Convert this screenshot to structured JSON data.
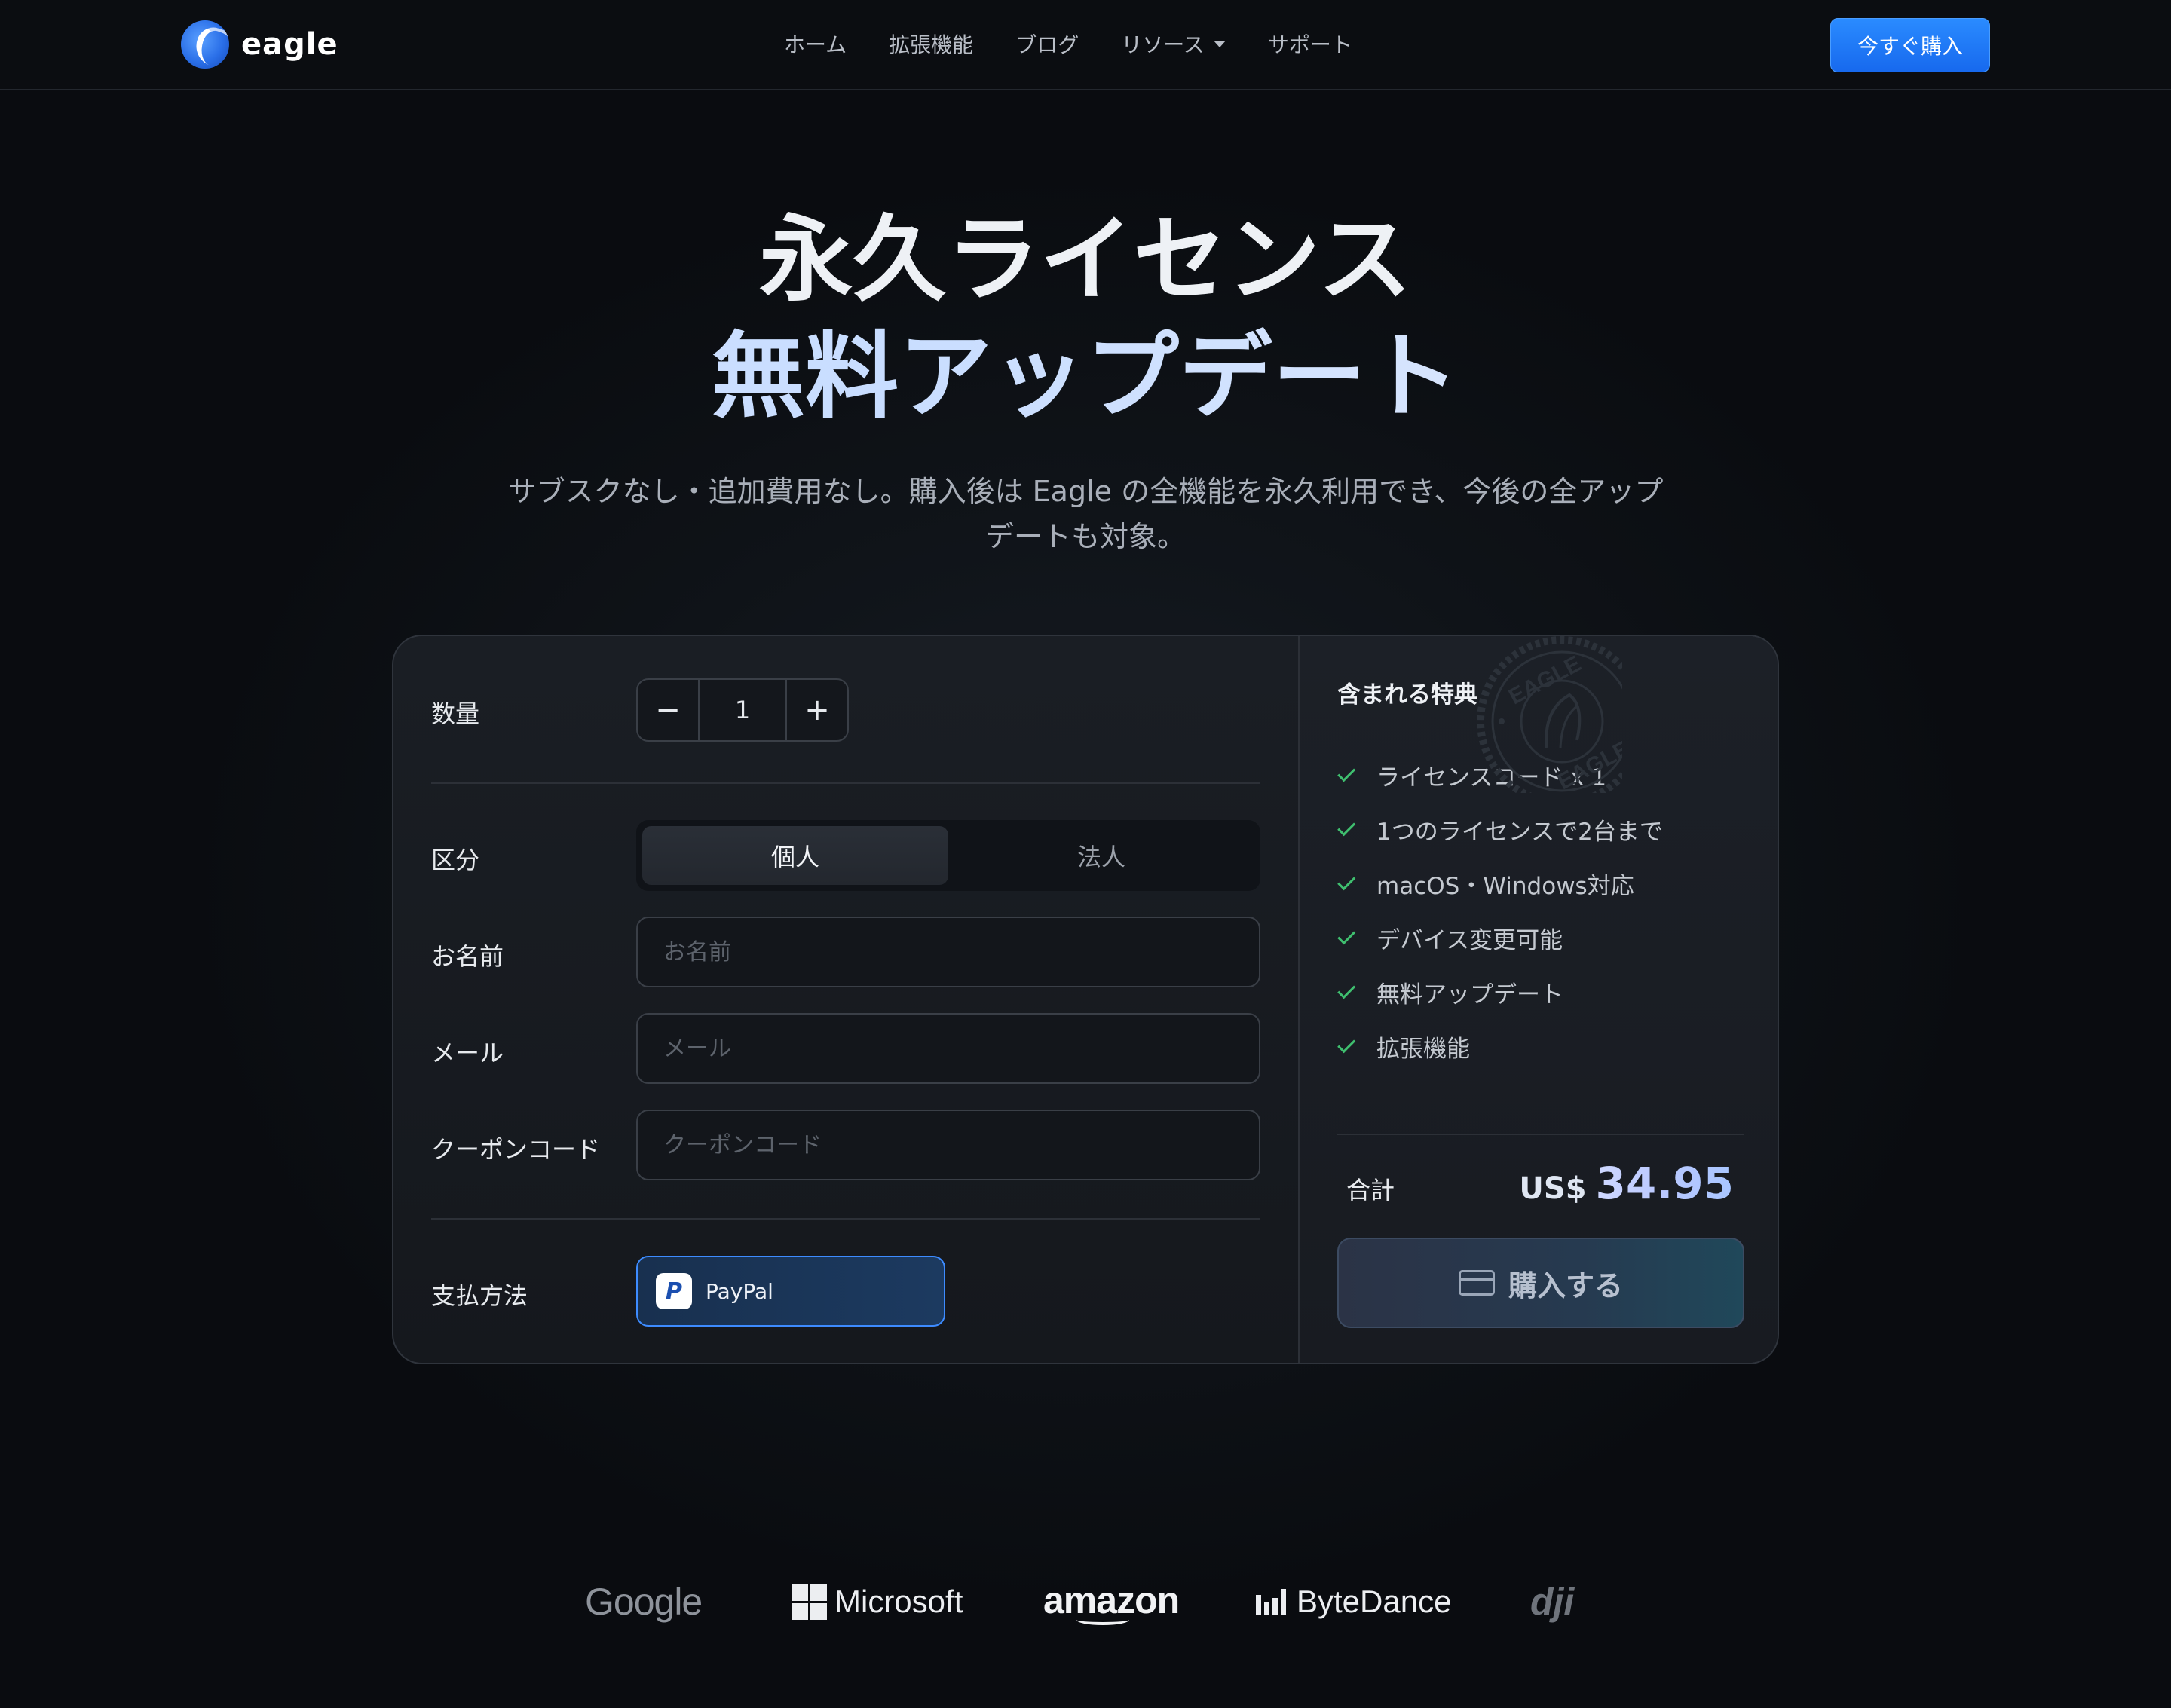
{
  "nav": {
    "brand": "eagle",
    "items": [
      {
        "label": "ホーム"
      },
      {
        "label": "拡張機能"
      },
      {
        "label": "ブログ"
      },
      {
        "label": "リソース"
      },
      {
        "label": "サポート"
      }
    ],
    "cta": "今すぐ購入"
  },
  "hero": {
    "line1": "永久ライセンス",
    "line2": "無料アップデート",
    "subtitle": "サブスクなし・追加費用なし。購入後は Eagle の全機能を永久利用でき、今後の全アップデートも対象。"
  },
  "form": {
    "quantity_label": "数量",
    "quantity_value": "1",
    "minus": "−",
    "plus": "+",
    "type_label": "区分",
    "type_options": [
      "個人",
      "法人"
    ],
    "type_selected": "個人",
    "name_label": "お名前",
    "name_placeholder": "お名前",
    "name_value": "",
    "email_label": "メール",
    "email_placeholder": "メール",
    "email_value": "",
    "coupon_label": "クーポンコード",
    "coupon_placeholder": "クーポンコード",
    "coupon_value": "",
    "payment_label": "支払方法",
    "payment_method": "PayPal"
  },
  "summary": {
    "title": "含まれる特典",
    "features": [
      "ライセンスコード x 1",
      "1つのライセンスで2台まで",
      "macOS・Windows対応",
      "デバイス変更可能",
      "無料アップデート",
      "拡張機能"
    ],
    "stamp_text": "EAGLE",
    "total_label": "合計",
    "currency": "US$",
    "amount": "34.95",
    "purchase_label": "購入する"
  },
  "logos": [
    "Google",
    "Microsoft",
    "amazon",
    "ByteDance",
    "dji"
  ],
  "colors": {
    "accent": "#1f7bff",
    "check": "#3fbf6f",
    "background": "#0b0e12"
  }
}
